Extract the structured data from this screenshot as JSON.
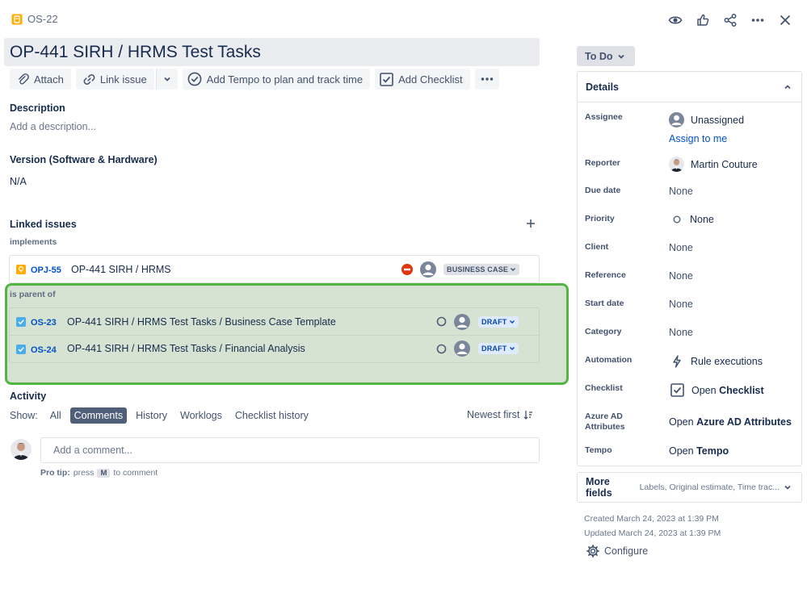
{
  "header": {
    "issue_key": "OS-22",
    "title": "OP-441 SIRH / HRMS Test Tasks"
  },
  "toolbar": {
    "attach": "Attach",
    "link_issue": "Link issue",
    "add_tempo": "Add Tempo to plan and track time",
    "add_checklist": "Add Checklist"
  },
  "description": {
    "label": "Description",
    "placeholder": "Add a description..."
  },
  "version": {
    "label": "Version (Software & Hardware)",
    "value": "N/A"
  },
  "linked_issues": {
    "label": "Linked issues",
    "implements_label": "implements",
    "implements": [
      {
        "key": "OPJ-55",
        "summary": "OP-441 SIRH / HRMS",
        "status": "BUSINESS CASE"
      }
    ],
    "parent_label": "is parent of",
    "children": [
      {
        "key": "OS-23",
        "summary": "OP-441 SIRH / HRMS Test Tasks / Business Case Template",
        "status": "DRAFT"
      },
      {
        "key": "OS-24",
        "summary": "OP-441 SIRH / HRMS Test Tasks / Financial Analysis",
        "status": "DRAFT"
      }
    ]
  },
  "activity": {
    "label": "Activity",
    "show_label": "Show:",
    "tabs": [
      "All",
      "Comments",
      "History",
      "Worklogs",
      "Checklist history"
    ],
    "selected_tab": "Comments",
    "sort": "Newest first",
    "comment_placeholder": "Add a comment...",
    "pro_tip_prefix": "Pro tip:",
    "pro_tip_press": "press",
    "pro_tip_key": "M",
    "pro_tip_suffix": "to comment"
  },
  "sidebar": {
    "status": "To Do",
    "details_label": "Details",
    "fields": {
      "assignee": {
        "label": "Assignee",
        "value": "Unassigned",
        "assign_link": "Assign to me"
      },
      "reporter": {
        "label": "Reporter",
        "value": "Martin Couture"
      },
      "due_date": {
        "label": "Due date",
        "value": "None"
      },
      "priority": {
        "label": "Priority",
        "value": "None"
      },
      "client": {
        "label": "Client",
        "value": "None"
      },
      "reference": {
        "label": "Reference",
        "value": "None"
      },
      "start_date": {
        "label": "Start date",
        "value": "None"
      },
      "category": {
        "label": "Category",
        "value": "None"
      },
      "automation": {
        "label": "Automation",
        "value": "Rule executions"
      },
      "checklist": {
        "label": "Checklist",
        "value_prefix": "Open",
        "value_bold": "Checklist"
      },
      "azure": {
        "label_line1": "Azure AD",
        "label_line2": "Attributes",
        "value_prefix": "Open",
        "value_bold": "Azure AD Attributes"
      },
      "tempo": {
        "label": "Tempo",
        "value_prefix": "Open",
        "value_bold": "Tempo"
      }
    },
    "more_fields_label": "More fields",
    "more_fields_hint": "Labels, Original estimate, Time trac...",
    "created": "Created March 24, 2023 at 1:39 PM",
    "updated": "Updated March 24, 2023 at 1:39 PM",
    "configure": "Configure"
  },
  "colors": {
    "accent_blue": "#0052cc",
    "parent_highlight_border": "#53b644",
    "blocked_red": "#de350b",
    "subtask_checkbox": "#4bade8",
    "story_icon": "#ffab00"
  },
  "icons": [
    "watch-icon",
    "like-icon",
    "share-icon",
    "more-icon",
    "close-icon",
    "attach-icon",
    "link-icon",
    "chevron-down-icon",
    "tempo-check-icon",
    "checklist-icon",
    "blocked-icon",
    "avatar-icon",
    "status-circle-icon",
    "sort-icon",
    "lightning-icon",
    "gear-icon"
  ]
}
